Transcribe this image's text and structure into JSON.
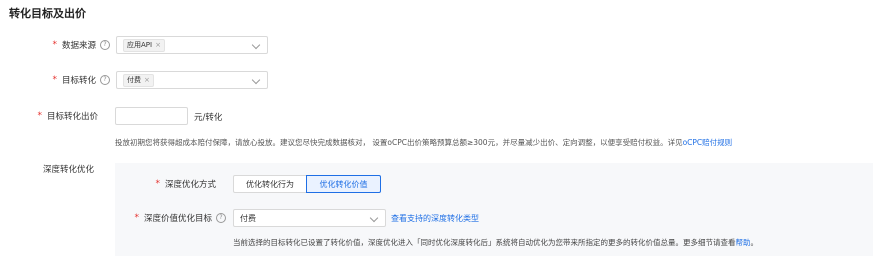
{
  "section": {
    "title": "转化目标及出价"
  },
  "data_source": {
    "label": "数据来源",
    "tag": "应用API",
    "tag_close": "×"
  },
  "target_conversion": {
    "label": "目标转化",
    "tag": "付费",
    "tag_close": "×"
  },
  "bid": {
    "label": "目标转化出价",
    "value": "",
    "unit": "元/转化",
    "note_prefix": "投放初期您将获得超成本赔付保障，请放心投放。建议您尽快完成数据核对，  设置oCPC出价策略预算总额≥300元，并尽量减少出价、定向调整，以便享受赔付权益。详见",
    "note_link": "oCPC赔付规则"
  },
  "deep": {
    "section_label": "深度转化优化",
    "mode_label": "深度优化方式",
    "mode_options": [
      "优化转化行为",
      "优化转化价值"
    ],
    "mode_selected": "优化转化价值",
    "target_label": "深度价值优化目标",
    "target_value": "付费",
    "target_link": "查看支持的深度转化类型",
    "note_prefix": "当前选择的目标转化已设置了转化价值，深度优化进入「同时优化深度转化后」系统将自动优化为您带来所指定的更多的转化价值总量。更多细节请查看",
    "note_link": "帮助",
    "note_suffix": "。"
  },
  "required_mark": "*",
  "help_mark": "?",
  "colors": {
    "accent": "#1f6fe5",
    "required": "#e5322f",
    "panel": "#f7f8fa"
  }
}
